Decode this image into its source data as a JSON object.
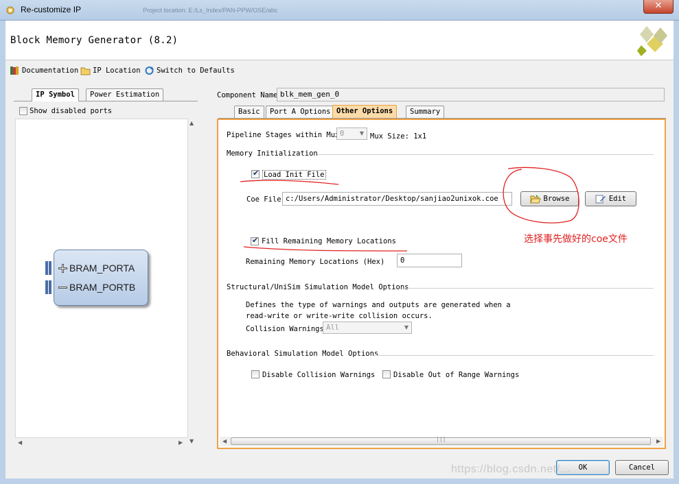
{
  "window": {
    "title": "Re-customize IP",
    "close_glyph": "✕",
    "ghost_text": "Project location: E:/Ls_Index/PAN-PPW/OSE/abc"
  },
  "header": {
    "app_title": "Block Memory Generator (8.2)"
  },
  "toolbar": {
    "documentation": "Documentation",
    "ip_location": "IP Location",
    "switch_defaults": "Switch to Defaults"
  },
  "left": {
    "tabs": [
      "IP Symbol",
      "Power Estimation"
    ],
    "show_disabled_ports": "Show disabled ports",
    "ports": [
      "BRAM_PORTA",
      "BRAM_PORTB"
    ]
  },
  "component": {
    "label": "Component Name",
    "value": "blk_mem_gen_0"
  },
  "right_tabs": [
    "Basic",
    "Port A Options",
    "Other Options",
    "Summary"
  ],
  "other_options": {
    "pipeline_label": "Pipeline Stages within Mux",
    "pipeline_value": "0",
    "mux_size": "Mux Size: 1x1",
    "mem_init_section": "Memory Initialization",
    "load_init_label": "Load Init File",
    "load_init_checked": true,
    "coe_label": "Coe File",
    "coe_value": "c:/Users/Administrator/Desktop/sanjiao2unixok.coe",
    "browse_label": "Browse",
    "edit_label": "Edit",
    "fill_remaining_label": "Fill Remaining Memory Locations",
    "fill_remaining_checked": true,
    "remaining_label": "Remaining Memory Locations (Hex)",
    "remaining_value": "0",
    "structural_section": "Structural/UniSim Simulation Model Options",
    "structural_desc_1": "Defines the type of warnings and outputs are generated when a",
    "structural_desc_2": "read-write or write-write collision occurs.",
    "collision_label": "Collision Warnings",
    "collision_value": "All",
    "behavioral_section": "Behavioral Simulation Model Options",
    "disable_collision": "Disable Collision Warnings",
    "disable_range": "Disable Out of Range Warnings"
  },
  "annotation": "选择事先做好的coe文件",
  "footer": {
    "ok": "OK",
    "cancel": "Cancel"
  },
  "watermark": "https://blog.csdn.net/...",
  "colors": {
    "annotation_red": "#e02020",
    "active_tab_orange": "#f0a040"
  }
}
